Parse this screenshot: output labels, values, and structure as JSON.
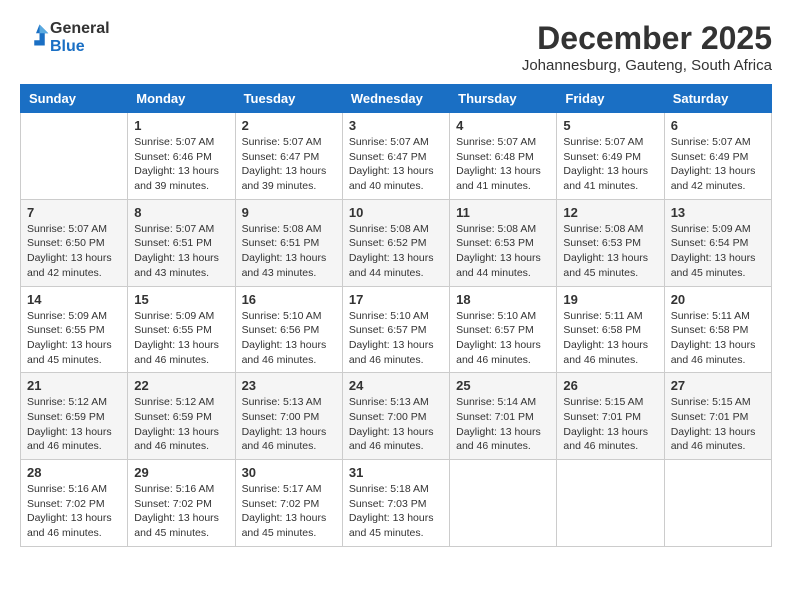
{
  "header": {
    "logo_line1": "General",
    "logo_line2": "Blue",
    "month": "December 2025",
    "location": "Johannesburg, Gauteng, South Africa"
  },
  "weekdays": [
    "Sunday",
    "Monday",
    "Tuesday",
    "Wednesday",
    "Thursday",
    "Friday",
    "Saturday"
  ],
  "weeks": [
    [
      {
        "day": "",
        "info": ""
      },
      {
        "day": "1",
        "info": "Sunrise: 5:07 AM\nSunset: 6:46 PM\nDaylight: 13 hours\nand 39 minutes."
      },
      {
        "day": "2",
        "info": "Sunrise: 5:07 AM\nSunset: 6:47 PM\nDaylight: 13 hours\nand 39 minutes."
      },
      {
        "day": "3",
        "info": "Sunrise: 5:07 AM\nSunset: 6:47 PM\nDaylight: 13 hours\nand 40 minutes."
      },
      {
        "day": "4",
        "info": "Sunrise: 5:07 AM\nSunset: 6:48 PM\nDaylight: 13 hours\nand 41 minutes."
      },
      {
        "day": "5",
        "info": "Sunrise: 5:07 AM\nSunset: 6:49 PM\nDaylight: 13 hours\nand 41 minutes."
      },
      {
        "day": "6",
        "info": "Sunrise: 5:07 AM\nSunset: 6:49 PM\nDaylight: 13 hours\nand 42 minutes."
      }
    ],
    [
      {
        "day": "7",
        "info": "Sunrise: 5:07 AM\nSunset: 6:50 PM\nDaylight: 13 hours\nand 42 minutes."
      },
      {
        "day": "8",
        "info": "Sunrise: 5:07 AM\nSunset: 6:51 PM\nDaylight: 13 hours\nand 43 minutes."
      },
      {
        "day": "9",
        "info": "Sunrise: 5:08 AM\nSunset: 6:51 PM\nDaylight: 13 hours\nand 43 minutes."
      },
      {
        "day": "10",
        "info": "Sunrise: 5:08 AM\nSunset: 6:52 PM\nDaylight: 13 hours\nand 44 minutes."
      },
      {
        "day": "11",
        "info": "Sunrise: 5:08 AM\nSunset: 6:53 PM\nDaylight: 13 hours\nand 44 minutes."
      },
      {
        "day": "12",
        "info": "Sunrise: 5:08 AM\nSunset: 6:53 PM\nDaylight: 13 hours\nand 45 minutes."
      },
      {
        "day": "13",
        "info": "Sunrise: 5:09 AM\nSunset: 6:54 PM\nDaylight: 13 hours\nand 45 minutes."
      }
    ],
    [
      {
        "day": "14",
        "info": "Sunrise: 5:09 AM\nSunset: 6:55 PM\nDaylight: 13 hours\nand 45 minutes."
      },
      {
        "day": "15",
        "info": "Sunrise: 5:09 AM\nSunset: 6:55 PM\nDaylight: 13 hours\nand 46 minutes."
      },
      {
        "day": "16",
        "info": "Sunrise: 5:10 AM\nSunset: 6:56 PM\nDaylight: 13 hours\nand 46 minutes."
      },
      {
        "day": "17",
        "info": "Sunrise: 5:10 AM\nSunset: 6:57 PM\nDaylight: 13 hours\nand 46 minutes."
      },
      {
        "day": "18",
        "info": "Sunrise: 5:10 AM\nSunset: 6:57 PM\nDaylight: 13 hours\nand 46 minutes."
      },
      {
        "day": "19",
        "info": "Sunrise: 5:11 AM\nSunset: 6:58 PM\nDaylight: 13 hours\nand 46 minutes."
      },
      {
        "day": "20",
        "info": "Sunrise: 5:11 AM\nSunset: 6:58 PM\nDaylight: 13 hours\nand 46 minutes."
      }
    ],
    [
      {
        "day": "21",
        "info": "Sunrise: 5:12 AM\nSunset: 6:59 PM\nDaylight: 13 hours\nand 46 minutes."
      },
      {
        "day": "22",
        "info": "Sunrise: 5:12 AM\nSunset: 6:59 PM\nDaylight: 13 hours\nand 46 minutes."
      },
      {
        "day": "23",
        "info": "Sunrise: 5:13 AM\nSunset: 7:00 PM\nDaylight: 13 hours\nand 46 minutes."
      },
      {
        "day": "24",
        "info": "Sunrise: 5:13 AM\nSunset: 7:00 PM\nDaylight: 13 hours\nand 46 minutes."
      },
      {
        "day": "25",
        "info": "Sunrise: 5:14 AM\nSunset: 7:01 PM\nDaylight: 13 hours\nand 46 minutes."
      },
      {
        "day": "26",
        "info": "Sunrise: 5:15 AM\nSunset: 7:01 PM\nDaylight: 13 hours\nand 46 minutes."
      },
      {
        "day": "27",
        "info": "Sunrise: 5:15 AM\nSunset: 7:01 PM\nDaylight: 13 hours\nand 46 minutes."
      }
    ],
    [
      {
        "day": "28",
        "info": "Sunrise: 5:16 AM\nSunset: 7:02 PM\nDaylight: 13 hours\nand 46 minutes."
      },
      {
        "day": "29",
        "info": "Sunrise: 5:16 AM\nSunset: 7:02 PM\nDaylight: 13 hours\nand 45 minutes."
      },
      {
        "day": "30",
        "info": "Sunrise: 5:17 AM\nSunset: 7:02 PM\nDaylight: 13 hours\nand 45 minutes."
      },
      {
        "day": "31",
        "info": "Sunrise: 5:18 AM\nSunset: 7:03 PM\nDaylight: 13 hours\nand 45 minutes."
      },
      {
        "day": "",
        "info": ""
      },
      {
        "day": "",
        "info": ""
      },
      {
        "day": "",
        "info": ""
      }
    ]
  ]
}
